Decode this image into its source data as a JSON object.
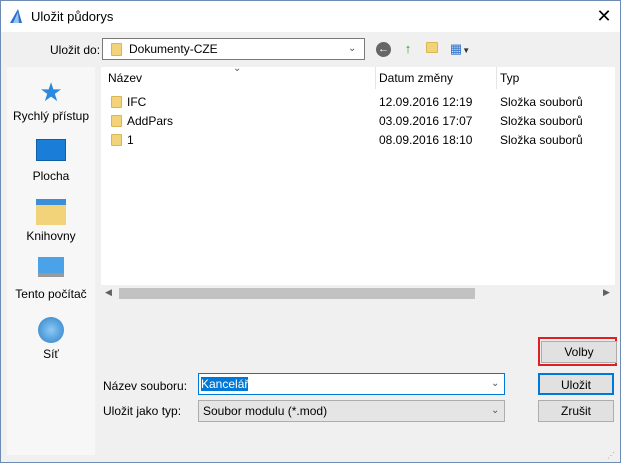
{
  "window": {
    "title": "Uložit půdorys",
    "close": "✕"
  },
  "toolbar": {
    "save_in_label": "Uložit do:",
    "save_in_value": "Dokumenty-CZE"
  },
  "places": [
    {
      "label": "Rychlý přístup"
    },
    {
      "label": "Plocha"
    },
    {
      "label": "Knihovny"
    },
    {
      "label": "Tento počítač"
    },
    {
      "label": "Síť"
    }
  ],
  "list": {
    "columns": [
      "Název",
      "Datum změny",
      "Typ"
    ],
    "rows": [
      {
        "name": "IFC",
        "date": "12.09.2016 12:19",
        "type": "Složka souborů"
      },
      {
        "name": "AddPars",
        "date": "03.09.2016 17:07",
        "type": "Složka souborů"
      },
      {
        "name": "1",
        "date": "08.09.2016 18:10",
        "type": "Složka souborů"
      }
    ]
  },
  "form": {
    "filename_label": "Název souboru:",
    "filename_value": "Kancelář",
    "type_label": "Uložit jako typ:",
    "type_value": "Soubor modulu (*.mod)"
  },
  "buttons": {
    "options": "Volby",
    "save": "Uložit",
    "cancel": "Zrušit"
  }
}
